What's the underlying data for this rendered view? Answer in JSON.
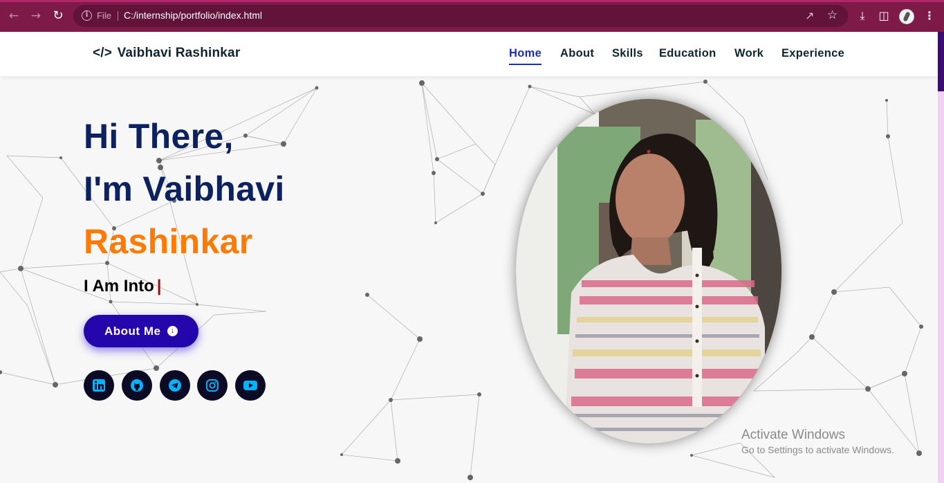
{
  "browser": {
    "file_label": "File",
    "url": "C:/internship/portfolio/index.html",
    "icons": [
      "back-arrow-icon",
      "forward-arrow-icon",
      "reload-icon",
      "info-icon",
      "share-icon",
      "star-icon",
      "download-icon",
      "side-panel-icon",
      "profile-avatar-icon",
      "menu-dots-icon"
    ],
    "theme_color": "#7d1a47"
  },
  "header": {
    "brand": "Vaibhavi Rashinkar",
    "brand_code": "</>",
    "nav": [
      {
        "label": "Home",
        "active": true
      },
      {
        "label": "About",
        "active": false
      },
      {
        "label": "Skills",
        "active": false
      },
      {
        "label": "Education",
        "active": false
      },
      {
        "label": "Work",
        "active": false
      },
      {
        "label": "Experience",
        "active": false
      }
    ],
    "active_color": "#1b2dc2"
  },
  "hero": {
    "line1": "Hi There,",
    "line2": "I'm Vaibhavi",
    "line3": "Rashinkar",
    "subtitle": "I Am Into",
    "cursor": "|",
    "button_label": "About Me",
    "accent_color": "#ff7a00",
    "button_color": "#2506ad",
    "social": [
      {
        "icon": "linkedin-icon",
        "glyph": "in"
      },
      {
        "icon": "github-icon",
        "glyph": ""
      },
      {
        "icon": "telegram-icon",
        "glyph": ""
      },
      {
        "icon": "instagram-icon",
        "glyph": ""
      },
      {
        "icon": "youtube-icon",
        "glyph": ""
      }
    ]
  },
  "watermark": {
    "title": "Activate Windows",
    "subtitle": "Go to Settings to activate Windows."
  }
}
